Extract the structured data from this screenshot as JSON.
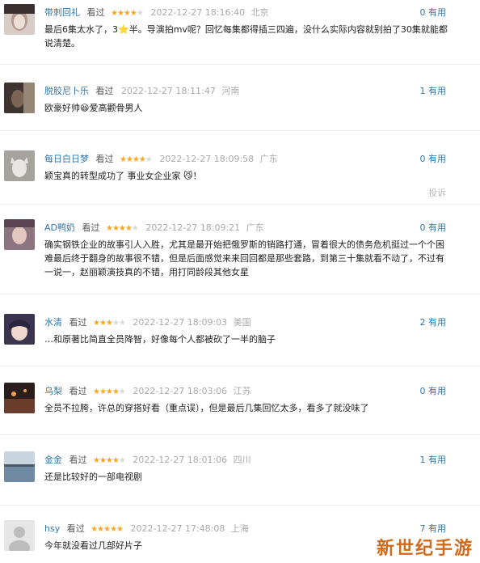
{
  "action_label": "看过",
  "useful_suffix": "有用",
  "report_label": "投诉",
  "watermark": "新世纪手游",
  "comments": [
    {
      "user": "带刺回礼",
      "stars": 4,
      "time": "2022-12-27 18:16:40",
      "location": "北京",
      "useful": "0",
      "text_parts": [
        "最后6集太水了，3",
        "半。导演拍mv呢？回忆每集都得插三四遍，没什么实际内容就别拍了30集就能都说清楚。"
      ],
      "icon": "star-emoji-icon",
      "avatar_color": "#c9b8b0"
    },
    {
      "user": "脱胶尼卜乐",
      "stars": 0,
      "time": "2022-12-27 18:11:47",
      "location": "河南",
      "useful": "1",
      "text_parts": [
        "欧豪好帅",
        "爱高颧骨男人"
      ],
      "icon": "grin-emoji-icon",
      "avatar_color": "#5a4a3e"
    },
    {
      "user": "每日白日梦",
      "stars": 4,
      "time": "2022-12-27 18:09:58",
      "location": "广东",
      "useful": "0",
      "text_parts": [
        "颖宝真的转型成功了 事业女企业家 ",
        "！"
      ],
      "icon": "cat-emoji-icon",
      "avatar_color": "#8d8b8a",
      "report": true
    },
    {
      "user": "AD鸭奶",
      "stars": 4,
      "time": "2022-12-27 18:09:21",
      "location": "广东",
      "useful": "0",
      "text_parts": [
        "确实钢铁企业的故事引人入胜，尤其是最开始把俄罗斯的销路打通，冒着很大的债务危机挺过一个个困难最后终于翻身的故事很不错，但是后面感觉来来回回都是那些套路，到第三十集就看不动了，不过有一说一，赵丽颖演技真的不错，用打同龄段其他女星"
      ],
      "avatar_color": "#7a6878"
    },
    {
      "user": "水清",
      "stars": 3,
      "time": "2022-12-27 18:09:03",
      "location": "美国",
      "useful": "2",
      "text_parts": [
        "…和原著比简直全员降智，好像每个人都被砍了一半的脑子"
      ],
      "avatar_color": "#3b3550"
    },
    {
      "user": "乌梨",
      "stars": 4,
      "time": "2022-12-27 18:03:06",
      "location": "江苏",
      "useful": "0",
      "text_parts": [
        "全员不拉胯，许总的穿搭好看（重点误），但是最后几集回忆太多，看多了就没味了"
      ],
      "avatar_color": "#4a2e2a"
    },
    {
      "user": "金金",
      "stars": 4,
      "time": "2022-12-27 18:01:06",
      "location": "四川",
      "useful": "1",
      "text_parts": [
        "还是比较好的一部电视剧"
      ],
      "avatar_color": "#8fa3b5"
    },
    {
      "user": "hsy",
      "stars": 5,
      "time": "2022-12-27 17:48:08",
      "location": "上海",
      "useful": "7",
      "text_parts": [
        "今年就没看过几部好片子"
      ],
      "avatar_color": "#dcdcdc"
    }
  ]
}
